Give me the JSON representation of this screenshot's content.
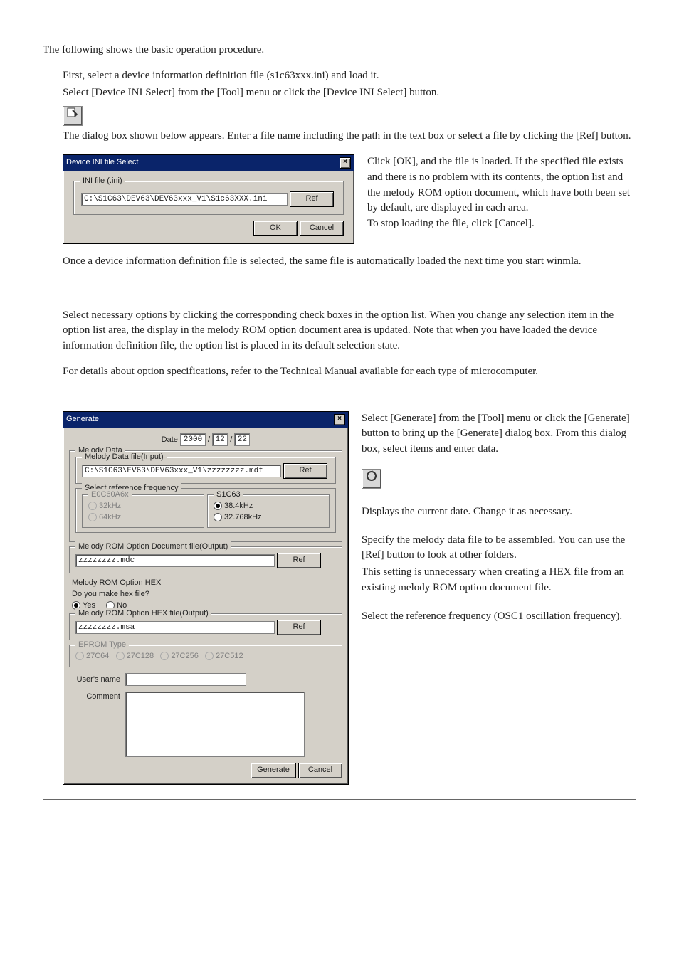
{
  "intro": "The following shows the basic operation procedure.",
  "step1": {
    "line1": "First, select a device information definition file (s1c63xxx.ini) and load it.",
    "line2": "Select [Device INI Select] from the [Tool] menu or click the [Device INI Select] button.",
    "after_icon": "The dialog box shown below appears. Enter a file name including the path in the text box or select a file by clicking the [Ref] button.",
    "right_para": "Click [OK], and the file is loaded. If the specified file exists and there is no problem with its contents, the option list and the melody ROM option document, which have both been set by default, are displayed in each area.",
    "right_para2": "To stop loading the file, click [Cancel].",
    "bottom": "Once a device information definition file is selected, the same file is automatically loaded the next time you start winmla."
  },
  "dlg1": {
    "title": "Device INI file Select",
    "legend": "INI file (.ini)",
    "path": "C:\\S1C63\\DEV63\\DEV63xxx_V1\\S1c63XXX.ini",
    "ref": "Ref",
    "ok": "OK",
    "cancel": "Cancel"
  },
  "step2": {
    "line1": "Select necessary options by clicking the corresponding check boxes in the option list. When you change any selection item in the option list area, the display in the melody ROM option document area is updated. Note that when you have loaded the device information definition file, the option list is placed in its default selection state.",
    "line2": "For details about option specifications, refer to the Technical Manual available for each type of microcomputer."
  },
  "step3": {
    "r1": "Select [Generate] from the [Tool] menu or click the [Generate] button to bring up the [Generate] dialog box. From this dialog box, select items and enter data.",
    "r2": "Displays the current date. Change it as necessary.",
    "r3a": "Specify the melody data file to be assembled. You can use the [Ref] button to look at other folders.",
    "r3b": "This setting is unnecessary when creating a HEX file from an existing melody ROM option document file.",
    "r4": "Select the reference frequency (OSC1 oscillation frequency)."
  },
  "dlg2": {
    "title": "Generate",
    "date_label": "Date",
    "date_y": "2000",
    "date_m": "12",
    "date_d": "22",
    "melody_data_legend": "Melody Data",
    "mdt_file_legend": "Melody Data file(Input)",
    "mdt_path": "C:\\S1C63\\EV63\\DEV63xxx_V1\\zzzzzzzz.mdt",
    "ref": "Ref",
    "freq_legend": "Select reference frequency",
    "freq_left_title": "E0C60A6x",
    "freq_left_a": "32kHz",
    "freq_left_b": "64kHz",
    "freq_right_title": "S1C63",
    "freq_right_a": "38.4kHz",
    "freq_right_b": "32.768kHz",
    "mdc_legend": "Melody ROM Option Document file(Output)",
    "mdc_path": "zzzzzzzz.mdc",
    "hex_group": "Melody ROM Option HEX",
    "hex_q": "Do you make hex file?",
    "yes": "Yes",
    "no": "No",
    "hex_file_legend": "Melody ROM Option HEX file(Output)",
    "hex_path": "zzzzzzzz.msa",
    "eprom_legend": "EPROM Type",
    "e1": "27C64",
    "e2": "27C128",
    "e3": "27C256",
    "e4": "27C512",
    "user_label": "User's name",
    "comment_label": "Comment",
    "generate": "Generate",
    "cancel": "Cancel"
  }
}
